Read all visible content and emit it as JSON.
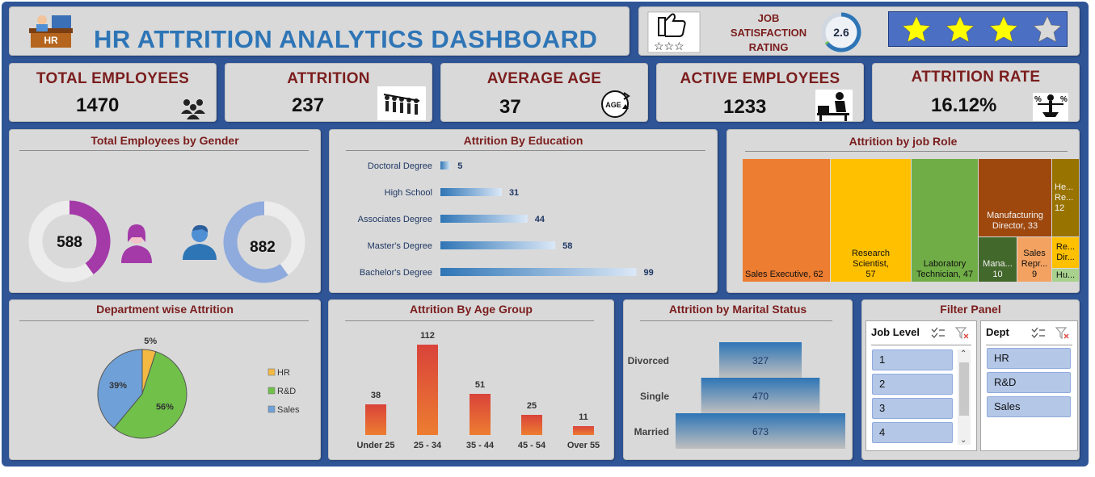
{
  "header": {
    "title": "HR ATTRITION ANALYTICS DASHBOARD",
    "logo_label": "HR",
    "job_satisfaction_label": [
      "JOB",
      "SATISFACTION",
      "RATING"
    ],
    "job_satisfaction_value": "2.6",
    "rating_stars_filled": 3,
    "rating_stars_total": 4
  },
  "kpis": [
    {
      "label": "TOTAL EMPLOYEES",
      "value": "1470",
      "icon": "people-group-icon"
    },
    {
      "label": "ATTRITION",
      "value": "237",
      "icon": "people-leaving-icon"
    },
    {
      "label": "AVERAGE AGE",
      "value": "37",
      "icon": "age-icon",
      "icon_text": "AGE"
    },
    {
      "label": "ACTIVE EMPLOYEES",
      "value": "1233",
      "icon": "person-at-desk-icon"
    },
    {
      "label": "ATTRITION RATE",
      "value": "16.12%",
      "icon": "percent-balance-icon"
    }
  ],
  "colors": {
    "frame": "#2f5597",
    "panel": "#d9d9d9",
    "title_red": "#7b1d1d",
    "title_blue": "#2e75b6",
    "female": "#a33aa8",
    "male": "#8faadc",
    "hr": "#f4b942",
    "rd": "#70c04a",
    "sales": "#6fa1d8",
    "bar_orange": "#ed7d31",
    "bar_red": "#d9433a"
  },
  "panels": {
    "gender": {
      "title": "Total Employees by Gender"
    },
    "education": {
      "title": "Attrition By Education"
    },
    "job_role": {
      "title": "Attrition by job Role"
    },
    "department": {
      "title": "Department wise Attrition"
    },
    "age_group": {
      "title": "Attrition By Age Group"
    },
    "marital": {
      "title": "Attrition by Marital Status"
    },
    "filter": {
      "title": "Filter Panel"
    }
  },
  "chart_data": [
    {
      "type": "donut",
      "title": "Total Employees by Gender",
      "series": [
        {
          "name": "Female",
          "value": 588,
          "total": 1470
        },
        {
          "name": "Male",
          "value": 882,
          "total": 1470
        }
      ]
    },
    {
      "type": "bar",
      "orientation": "horizontal",
      "title": "Attrition By Education",
      "categories": [
        "Doctoral Degree",
        "High School",
        "Associates Degree",
        "Master's Degree",
        "Bachelor's Degree"
      ],
      "values": [
        5,
        31,
        44,
        58,
        99
      ]
    },
    {
      "type": "treemap",
      "title": "Attrition by job Role",
      "categories": [
        "Sales Executive",
        "Research Scientist",
        "Laboratory Technician",
        "Manufacturing Director",
        "Healthcare Representative",
        "Manager",
        "Sales Representative",
        "Research Director",
        "Human Resources"
      ],
      "display_labels": [
        "Sales Executive, 62",
        "Research Scientist, 57",
        "Laboratory Technician, 47",
        "Manufacturing Director, 33",
        "He... Re... 12",
        "Mana... 10",
        "Sales Repr... 9",
        "Re... Dir...",
        "Hu..."
      ],
      "values": [
        62,
        57,
        47,
        33,
        12,
        10,
        9,
        null,
        null
      ]
    },
    {
      "type": "pie",
      "title": "Department wise Attrition",
      "categories": [
        "HR",
        "R&D",
        "Sales"
      ],
      "values": [
        5,
        56,
        39
      ],
      "value_labels": [
        "5%",
        "56%",
        "39%"
      ],
      "legend": "right"
    },
    {
      "type": "bar",
      "title": "Attrition By Age Group",
      "categories": [
        "Under 25",
        "25 - 34",
        "35 - 44",
        "45 - 54",
        "Over 55"
      ],
      "values": [
        38,
        112,
        51,
        25,
        11
      ]
    },
    {
      "type": "bar",
      "orientation": "funnel",
      "title": "Attrition by Marital Status",
      "categories": [
        "Divorced",
        "Single",
        "Married"
      ],
      "values": [
        327,
        470,
        673
      ]
    }
  ],
  "filter_panel": {
    "job_level": {
      "header": "Job Level",
      "items": [
        "1",
        "2",
        "3",
        "4"
      ]
    },
    "dept": {
      "header": "Dept",
      "items": [
        "HR",
        "R&D",
        "Sales"
      ]
    }
  }
}
